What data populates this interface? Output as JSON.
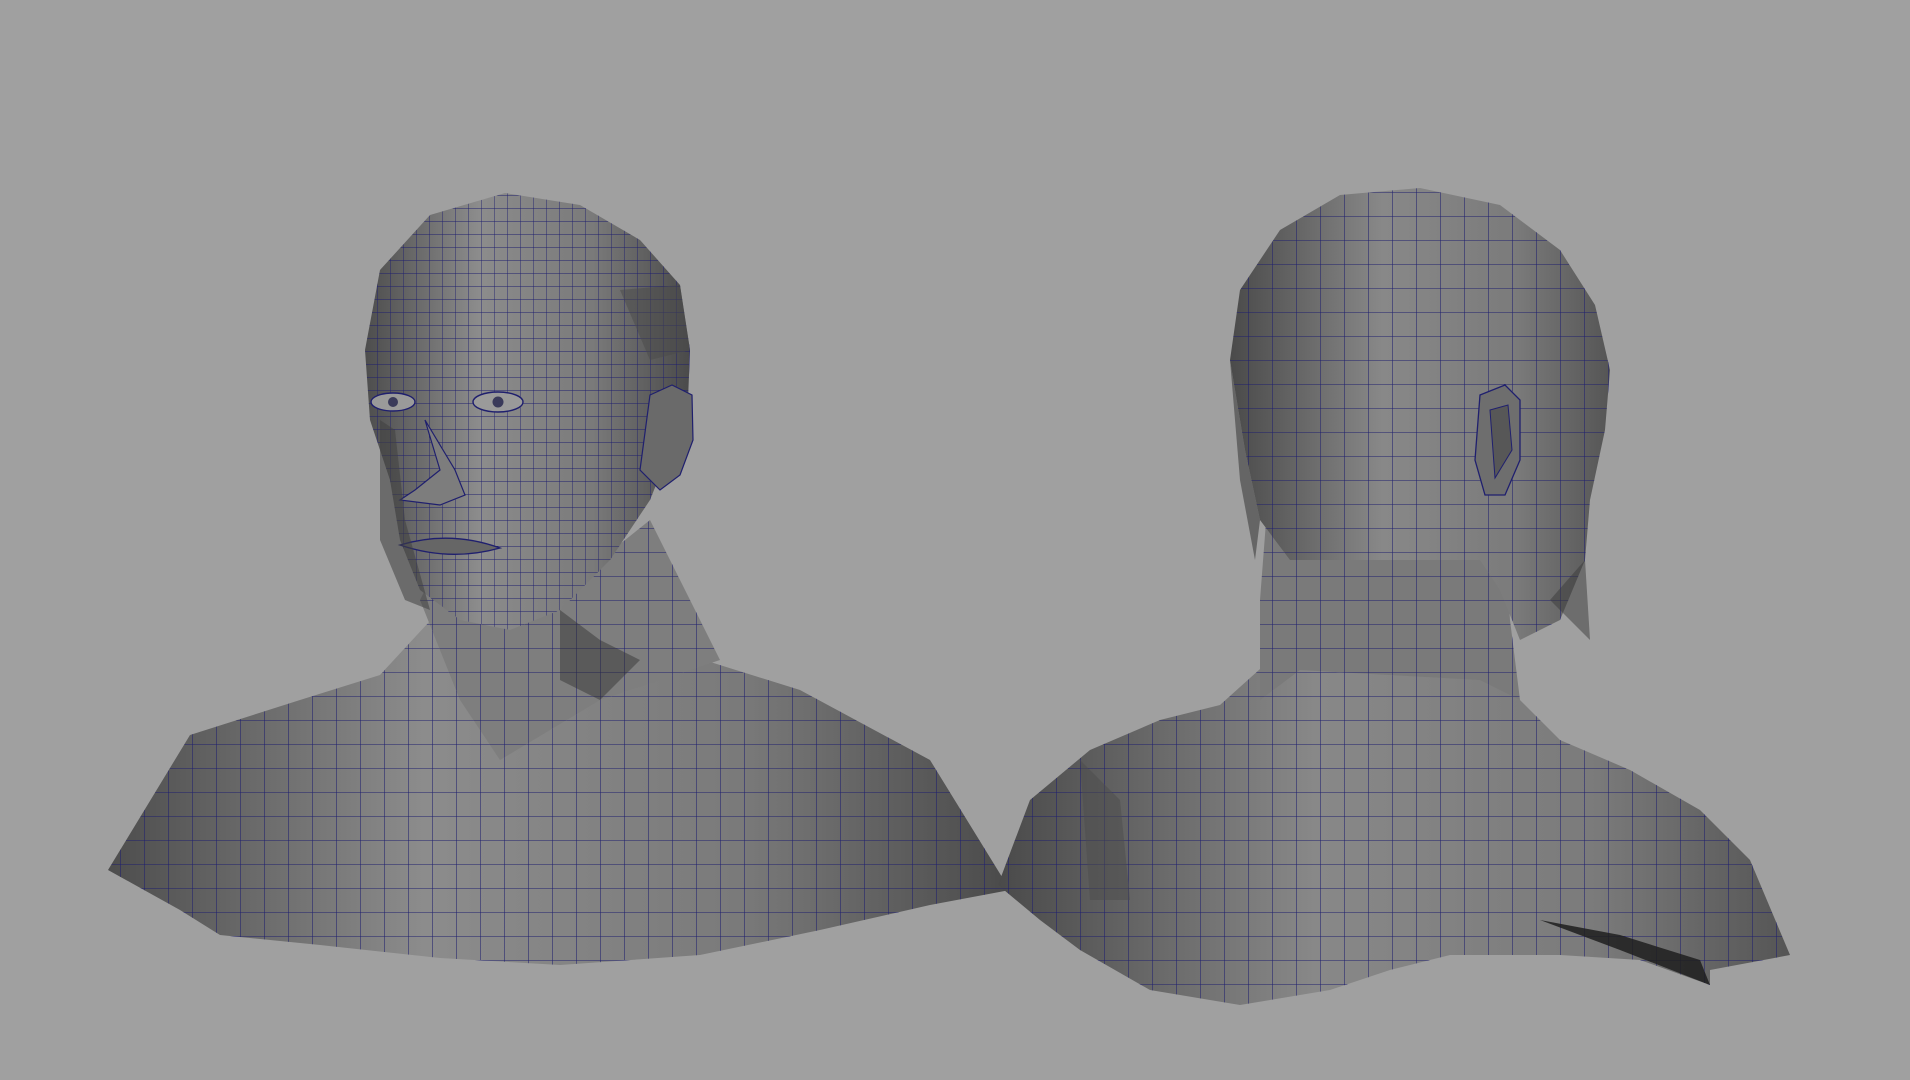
{
  "viewport": {
    "background": "#a0a0a0",
    "wire_color": "#1f1f6e",
    "shade_light": "#8a8a8a",
    "shade_mid": "#6f6f6f",
    "shade_dark": "#444444"
  },
  "models": [
    {
      "name": "head-bust-front-three-quarter"
    },
    {
      "name": "head-bust-back-three-quarter"
    }
  ]
}
